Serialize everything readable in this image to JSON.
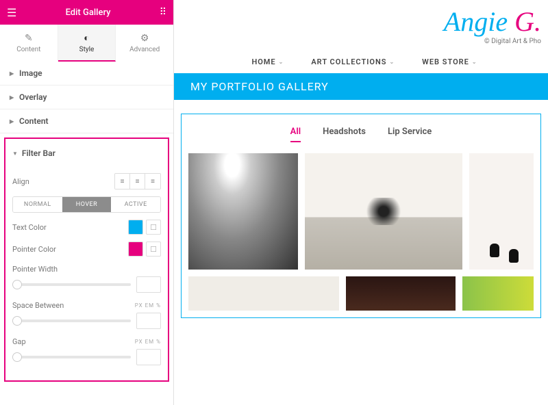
{
  "panel": {
    "title": "Edit Gallery",
    "tabs": {
      "content": "Content",
      "style": "Style",
      "advanced": "Advanced"
    },
    "sections": {
      "image": "Image",
      "overlay": "Overlay",
      "content": "Content"
    },
    "filterBar": {
      "title": "Filter Bar",
      "align": "Align",
      "states": {
        "normal": "NORMAL",
        "hover": "HOVER",
        "active": "ACTIVE"
      },
      "textColor": {
        "label": "Text Color",
        "value": "#00aeef"
      },
      "pointerColor": {
        "label": "Pointer Color",
        "value": "#e6007e"
      },
      "pointerWidth": "Pointer Width",
      "spaceBetween": "Space Between",
      "gap": "Gap",
      "units": "PX  EM  %"
    }
  },
  "site": {
    "logo": {
      "part1": "Angie ",
      "part2": "G."
    },
    "copyright": "© Digital Art & Pho",
    "nav": {
      "home": "HOME",
      "collections": "ART COLLECTIONS",
      "store": "WEB STORE"
    },
    "pageTitle": "MY PORTFOLIO GALLERY",
    "filters": {
      "all": "All",
      "headshots": "Headshots",
      "lipservice": "Lip Service"
    }
  }
}
